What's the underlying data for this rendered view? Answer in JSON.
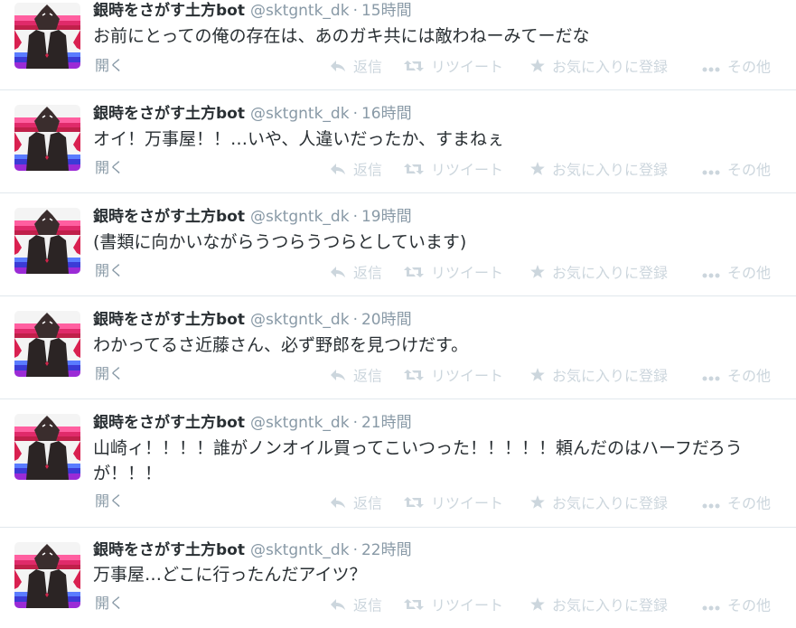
{
  "account": {
    "name": "銀時をさがす土方bot",
    "handle": "@sktgntk_dk",
    "separator": "·"
  },
  "actions": {
    "expand": "開く",
    "reply": "返信",
    "retweet": "リツイート",
    "favorite": "お気に入りに登録",
    "more": "その他"
  },
  "tweets": [
    {
      "time": "15時間",
      "text": "お前にとっての俺の存在は、あのガキ共には敵わねーみてーだな"
    },
    {
      "time": "16時間",
      "text": "オイ！万事屋！！…いや、人違いだったか、すまねぇ"
    },
    {
      "time": "19時間",
      "text": "(書類に向かいながらうつらうつらとしています)"
    },
    {
      "time": "20時間",
      "text": "わかってるさ近藤さん、必ず野郎を見つけだす。"
    },
    {
      "time": "21時間",
      "text": "山崎ィ！！！！誰がノンオイル買ってこいつった！！！！！頼んだのはハーフだろうが！！！"
    },
    {
      "time": "22時間",
      "text": "万事屋…どこに行ったんだアイツ？"
    }
  ],
  "colors": {
    "text": "#292f33",
    "meta": "#8899a6",
    "action": "#ccd6dd",
    "divider": "#e1e8ed"
  }
}
